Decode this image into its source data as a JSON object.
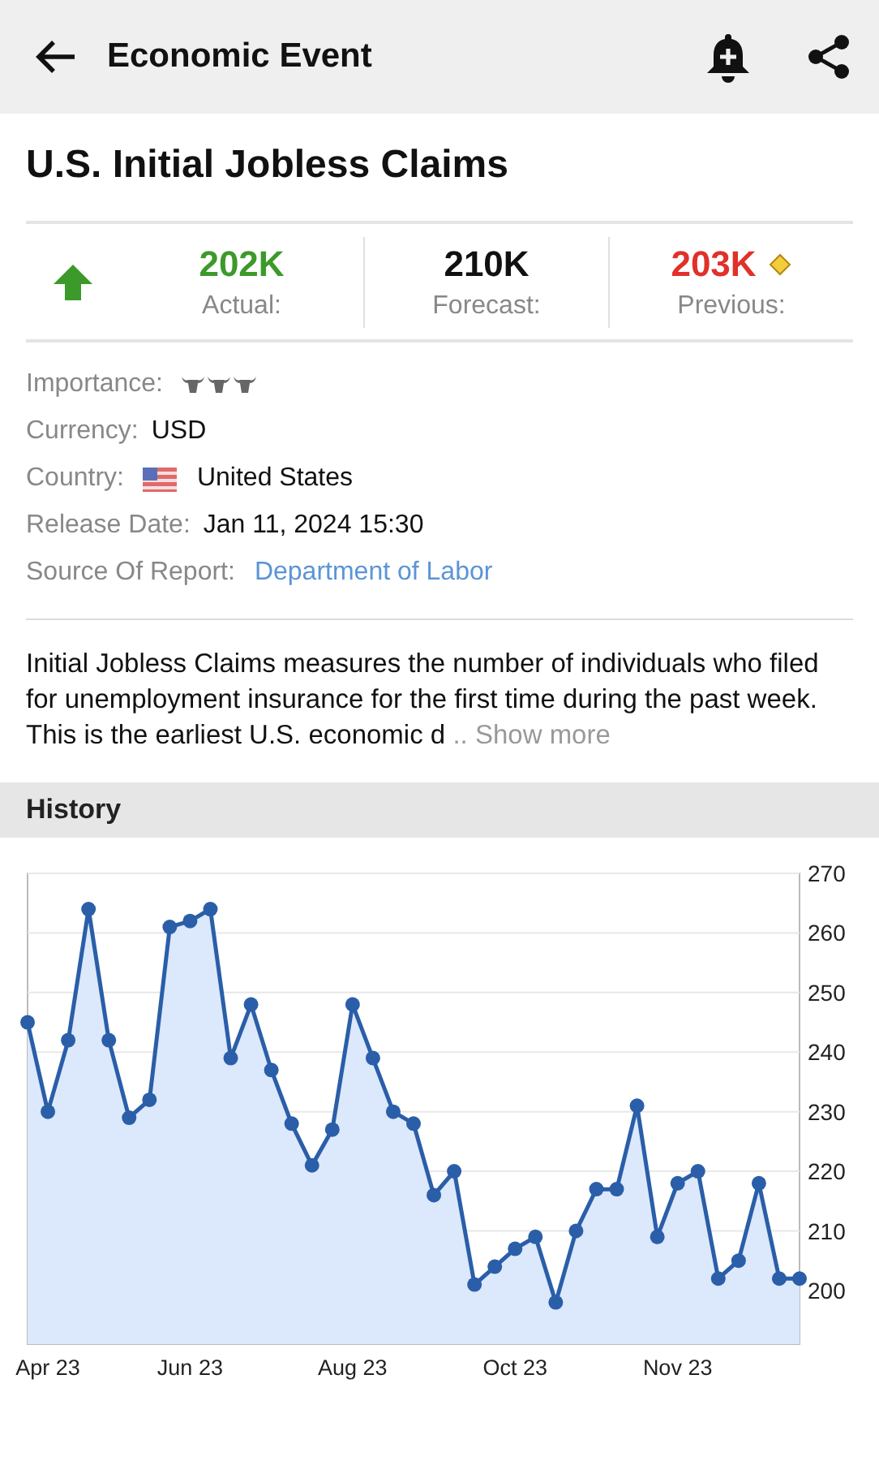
{
  "app_bar": {
    "title": "Economic Event"
  },
  "event": {
    "title": "U.S. Initial Jobless Claims"
  },
  "stats": {
    "indicator": {
      "kind": "up_arrow"
    },
    "items": [
      {
        "value": "202K",
        "label": "Actual:",
        "color": "#3c9a2a"
      },
      {
        "value": "210K",
        "label": "Forecast:",
        "color": "#111111"
      },
      {
        "value": "203K",
        "label": "Previous:",
        "color": "#e0312a",
        "revised": true
      }
    ]
  },
  "details": {
    "importance": {
      "label": "Importance:",
      "stars": 3
    },
    "currency": {
      "label": "Currency:",
      "value": "USD"
    },
    "country": {
      "label": "Country:",
      "value": "United States"
    },
    "release_date": {
      "label": "Release Date:",
      "value": "Jan 11, 2024 15:30"
    },
    "source": {
      "label": "Source Of Report:",
      "link": "Department of Labor"
    }
  },
  "description": {
    "text": "Initial Jobless Claims measures the number of individuals who filed for unemployment insurance for the first time during the past week. This is the earliest U.S. economic d",
    "more": ".. Show more"
  },
  "history": {
    "title": "History",
    "chart_data": {
      "type": "area",
      "categories": [
        null,
        "Apr 23",
        null,
        null,
        null,
        null,
        null,
        null,
        "Jun 23",
        null,
        null,
        null,
        null,
        null,
        null,
        null,
        "Aug 23",
        null,
        null,
        null,
        null,
        null,
        null,
        null,
        "Oct 23",
        null,
        null,
        null,
        null,
        null,
        null,
        null,
        "Nov 23",
        null,
        null,
        null,
        null,
        null,
        null
      ],
      "series": [
        {
          "color": "#2a5ea8",
          "values": [
            245,
            230,
            242,
            264,
            242,
            229,
            232,
            261,
            262,
            264,
            239,
            248,
            237,
            228,
            221,
            227,
            248,
            239,
            230,
            228,
            216,
            220,
            201,
            204,
            207,
            209,
            198,
            210,
            217,
            217,
            231,
            209,
            218,
            220,
            202,
            205,
            218,
            202,
            202
          ]
        }
      ],
      "grid": true,
      "ylim": [
        191,
        270
      ],
      "yticks": [
        200,
        210,
        220,
        230,
        240,
        250,
        260,
        270
      ]
    }
  }
}
